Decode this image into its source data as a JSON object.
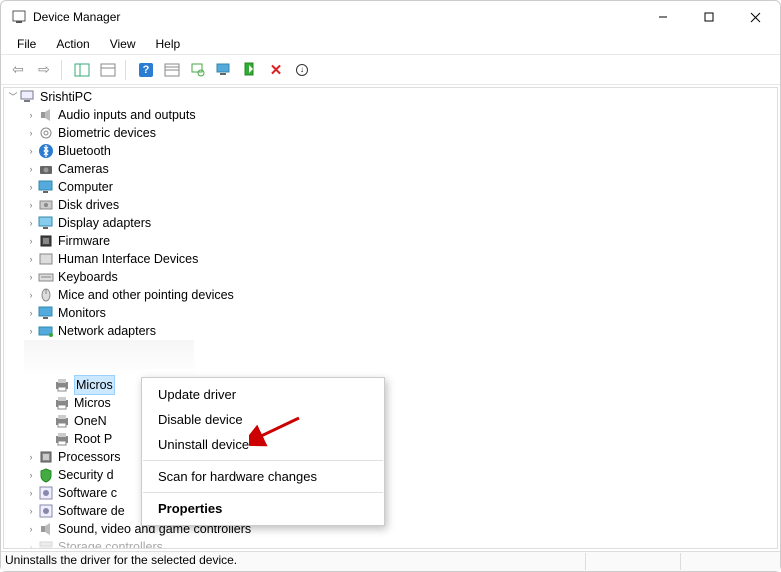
{
  "window": {
    "title": "Device Manager"
  },
  "menubar": [
    "File",
    "Action",
    "View",
    "Help"
  ],
  "toolbar_icons": [
    "back-icon",
    "forward-icon",
    "properties-pane-icon",
    "view-icon",
    "help-icon",
    "details-icon",
    "scan-icon",
    "monitor-icon",
    "enable-icon",
    "delete-icon",
    "update-icon"
  ],
  "tree": {
    "root": "SrishtiPC",
    "categories": [
      {
        "label": "Audio inputs and outputs",
        "icon": "speaker-icon"
      },
      {
        "label": "Biometric devices",
        "icon": "fingerprint-icon"
      },
      {
        "label": "Bluetooth",
        "icon": "bluetooth-icon"
      },
      {
        "label": "Cameras",
        "icon": "camera-icon"
      },
      {
        "label": "Computer",
        "icon": "monitor-icon"
      },
      {
        "label": "Disk drives",
        "icon": "drive-icon"
      },
      {
        "label": "Display adapters",
        "icon": "display-icon"
      },
      {
        "label": "Firmware",
        "icon": "firmware-icon"
      },
      {
        "label": "Human Interface Devices",
        "icon": "hid-icon"
      },
      {
        "label": "Keyboards",
        "icon": "keyboard-icon"
      },
      {
        "label": "Mice and other pointing devices",
        "icon": "mouse-icon"
      },
      {
        "label": "Monitors",
        "icon": "monitor-icon"
      },
      {
        "label": "Network adapters",
        "icon": "network-icon"
      }
    ],
    "expanded_children": [
      {
        "label": "Micros",
        "icon": "printer-icon",
        "selected": true
      },
      {
        "label": "Micros",
        "icon": "printer-icon"
      },
      {
        "label": "OneN",
        "icon": "printer-icon"
      },
      {
        "label": "Root P",
        "icon": "printer-icon"
      }
    ],
    "categories_after": [
      {
        "label": "Processors",
        "icon": "cpu-icon",
        "truncated": true
      },
      {
        "label": "Security d",
        "icon": "security-icon",
        "truncated": true
      },
      {
        "label": "Software c",
        "icon": "software-icon",
        "truncated": true
      },
      {
        "label": "Software de",
        "icon": "software-icon",
        "truncated_after": true
      },
      {
        "label": "Sound, video and game controllers",
        "icon": "sound-icon"
      },
      {
        "label": "Storage controllers",
        "icon": "storage-icon",
        "faded": true
      }
    ]
  },
  "context_menu": {
    "items": [
      {
        "label": "Update driver"
      },
      {
        "label": "Disable device"
      },
      {
        "label": "Uninstall device"
      }
    ],
    "items2": [
      {
        "label": "Scan for hardware changes"
      }
    ],
    "items3": [
      {
        "label": "Properties",
        "bold": true
      }
    ]
  },
  "statusbar": {
    "text": "Uninstalls the driver for the selected device."
  },
  "annotation": {
    "arrow_color": "#cc0000"
  }
}
